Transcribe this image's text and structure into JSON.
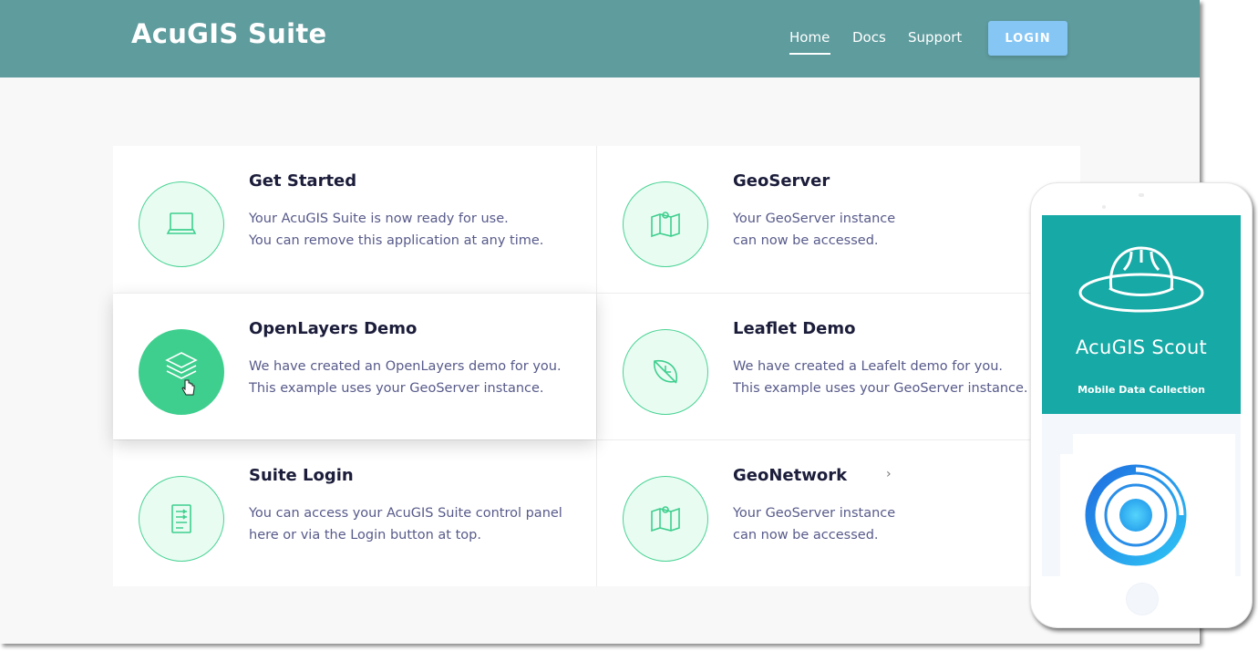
{
  "header": {
    "brand": "AcuGIS Suite",
    "nav": [
      {
        "label": "Home",
        "active": true
      },
      {
        "label": "Docs"
      },
      {
        "label": "Support"
      }
    ],
    "login_label": "LOGIN"
  },
  "cards": [
    {
      "title": "Get Started",
      "line1": "Your AcuGIS Suite is now ready for use.",
      "line2": "You can remove this application at any time.",
      "icon": "laptop-icon"
    },
    {
      "title": "GeoServer",
      "line1": "Your GeoServer instance",
      "line2": "can now be accessed.",
      "icon": "map-icon"
    },
    {
      "title": "OpenLayers Demo",
      "line1": "We have created an OpenLayers demo for you.",
      "line2": "This example uses your GeoServer instance.",
      "icon": "layers-icon"
    },
    {
      "title": "Leaflet Demo",
      "line1": "We have created a Leafelt demo for you.",
      "line2": "This example uses your GeoServer instance.",
      "icon": "leaf-icon"
    },
    {
      "title": "Suite Login",
      "line1": "You can access your AcuGIS Suite control panel",
      "line2": "here or via the Login button at top.",
      "icon": "checklist-icon"
    },
    {
      "title": "GeoNetwork",
      "line1": "Your GeoServer instance",
      "line2": "can now be accessed.",
      "icon": "map-icon"
    }
  ],
  "phone": {
    "app_title": "AcuGIS Scout",
    "app_subtitle": "Mobile Data Collection",
    "icons": [
      "hat-icon",
      "target-icon"
    ]
  },
  "colors": {
    "header_bg": "#5f9c9e",
    "accent_green": "#3ecf8e",
    "login_button": "#86c6f4",
    "scout_teal": "#16a9a5"
  }
}
